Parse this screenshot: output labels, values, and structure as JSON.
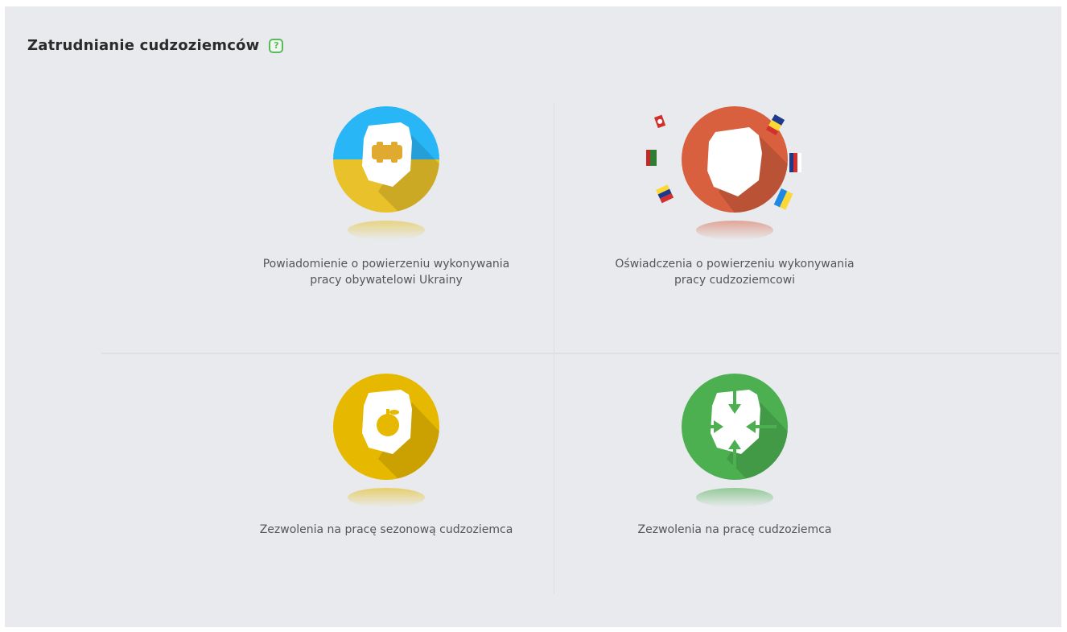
{
  "header": {
    "title": "Zatrudnianie cudzoziemców",
    "help_icon": "?"
  },
  "tiles": [
    {
      "label": "Powiadomienie o powierzeniu wykonywania pracy obywatelowi Ukrainy",
      "icon": "handshake-icon",
      "colors": {
        "top": "#29b6f6",
        "bottom": "#e9c12b"
      }
    },
    {
      "label": "Oświadczenia o powierzeniu wykonywania pracy cudzoziemcowi",
      "icon": "poland-map-icon",
      "colors": {
        "main": "#d9603f"
      }
    },
    {
      "label": "Zezwolenia na pracę sezonową cudzoziemca",
      "icon": "apple-icon",
      "colors": {
        "main": "#e6b800"
      }
    },
    {
      "label": "Zezwolenia na pracę cudzoziemca",
      "icon": "arrows-inward-icon",
      "colors": {
        "main": "#4caf50"
      }
    }
  ]
}
